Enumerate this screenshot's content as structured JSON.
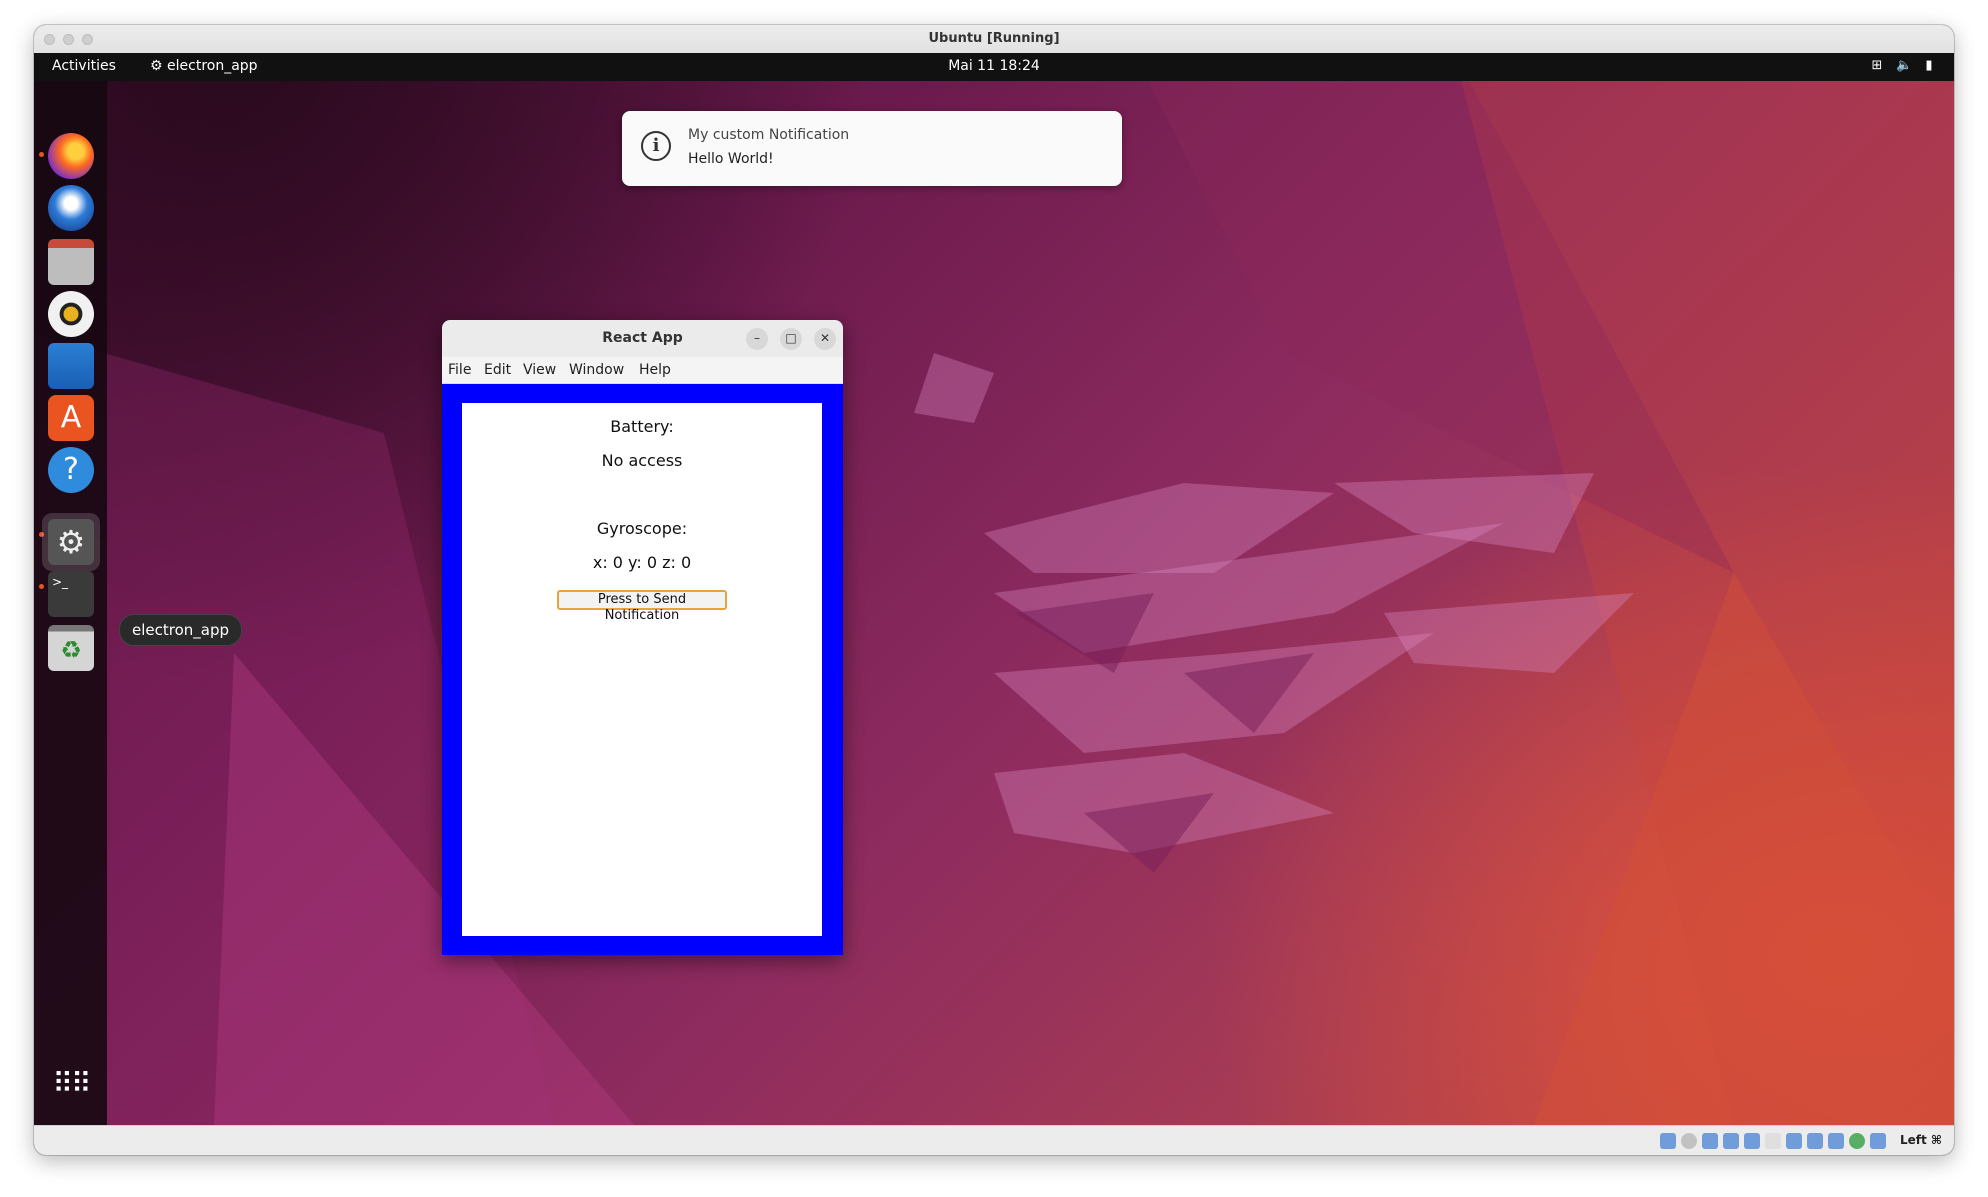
{
  "host": {
    "title": "Ubuntu [Running]",
    "host_key": "Left ⌘"
  },
  "topbar": {
    "activities": "Activities",
    "app_name": "electron_app",
    "clock": "Mai 11  18:24"
  },
  "dock": {
    "items": [
      "firefox",
      "thunderbird",
      "files",
      "rhythmbox",
      "libreoffice-writer",
      "app-center",
      "help",
      "electron_app",
      "terminal",
      "trash"
    ],
    "tooltip": "electron_app"
  },
  "notification": {
    "title": "My custom Notification",
    "body": "Hello World!"
  },
  "app_window": {
    "title": "React App",
    "menu": [
      "File",
      "Edit",
      "View",
      "Window",
      "Help"
    ],
    "battery_label": "Battery:",
    "battery_value": "No access",
    "gyroscope_label": "Gyroscope:",
    "gyroscope_value": "x: 0 y: 0 z: 0",
    "button_label": "Press to Send Notification"
  },
  "colors": {
    "accent_orange": "#e95420",
    "window_frame_blue": "#0000ff",
    "button_border": "#e8a33a"
  }
}
